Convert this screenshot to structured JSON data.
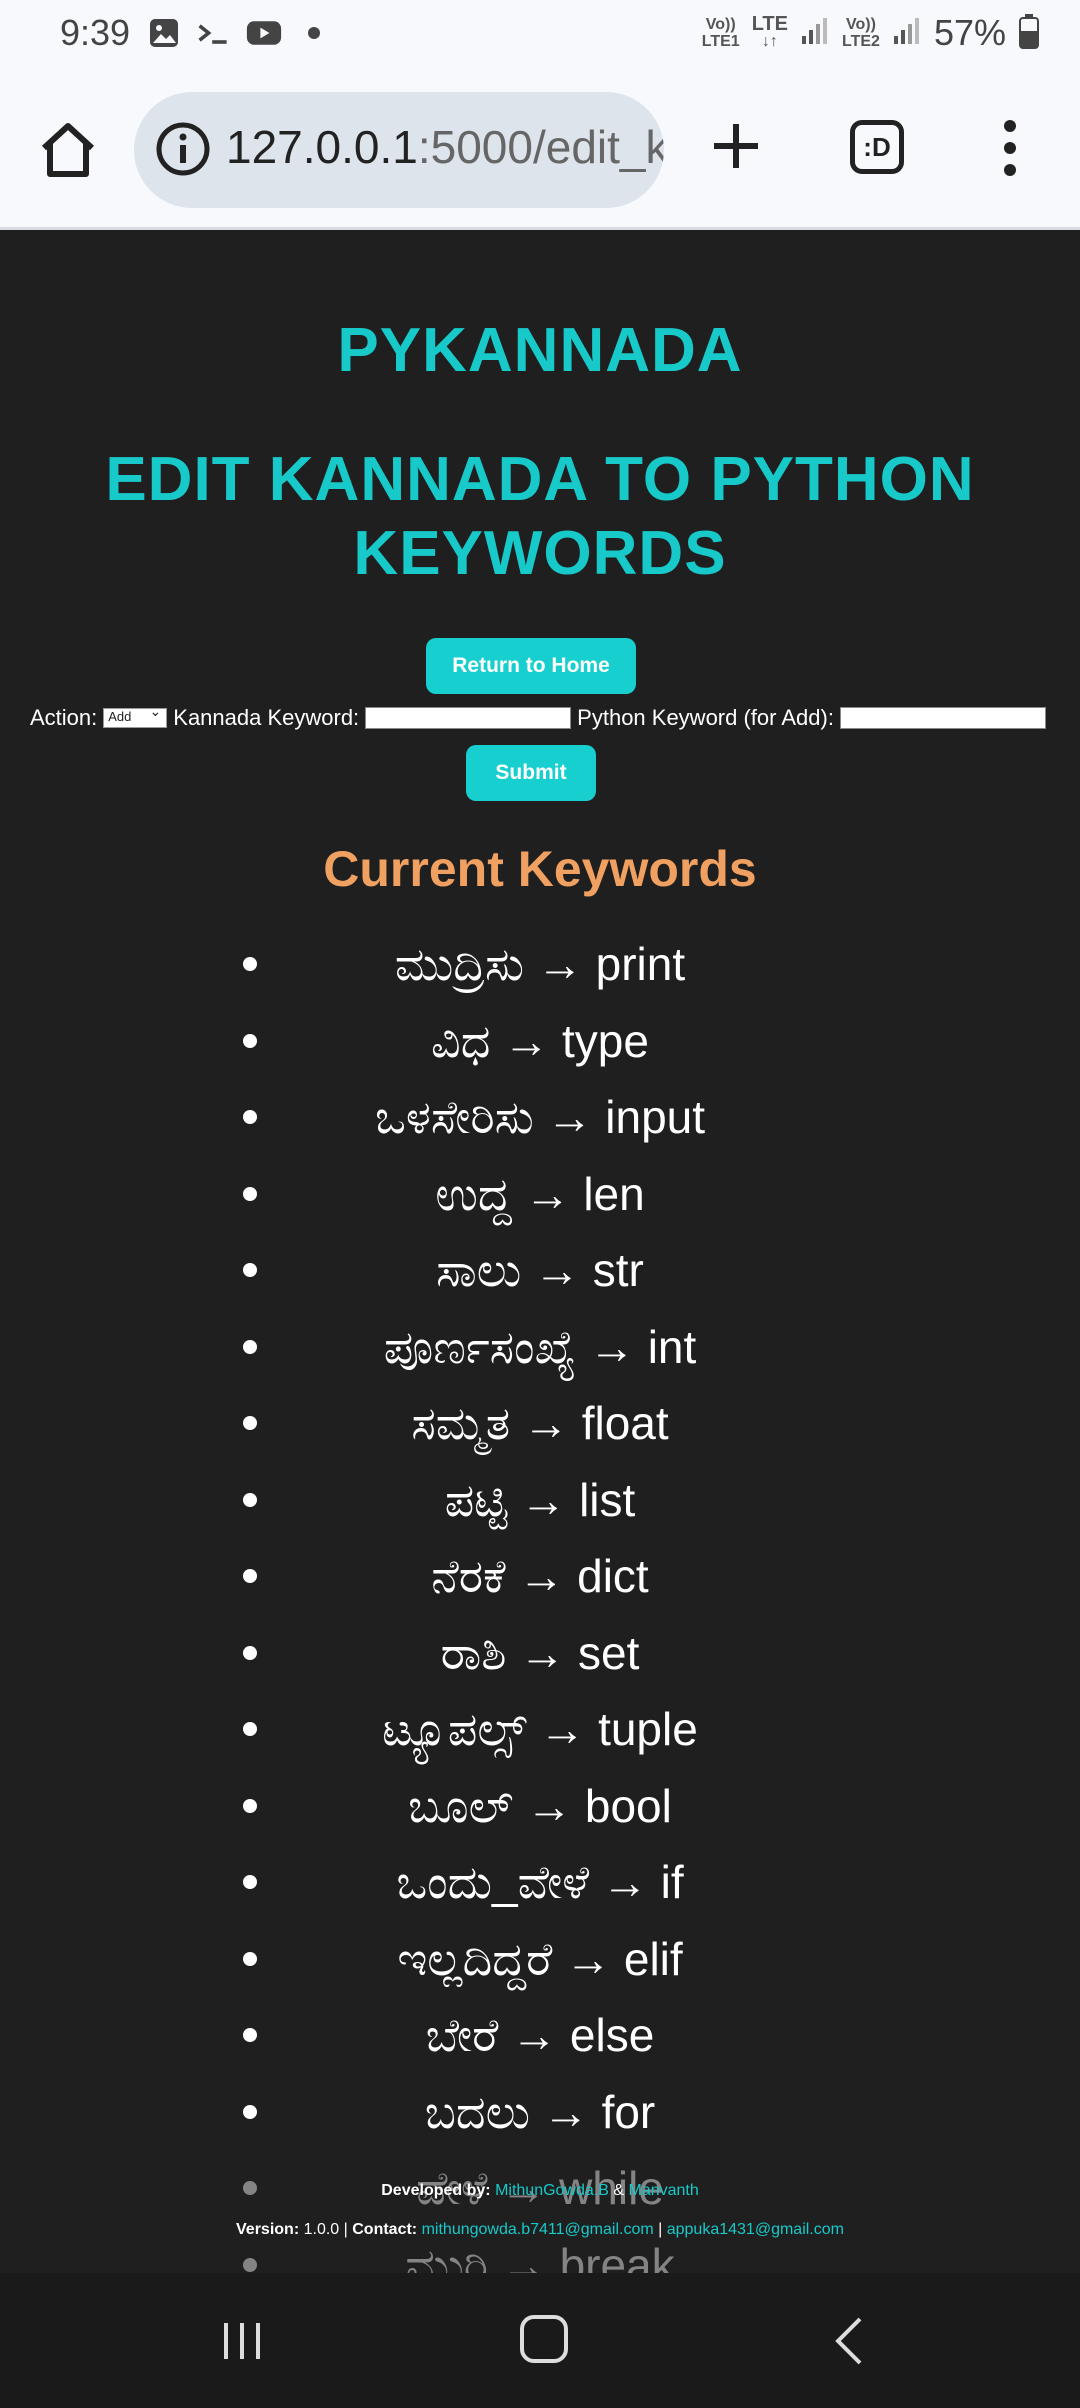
{
  "status_bar": {
    "time": "9:39",
    "icons": [
      "gallery-icon",
      "terminal-icon",
      "youtube-icon",
      "dot-icon"
    ],
    "sim1": [
      "Vo))",
      "LTE1"
    ],
    "lte": [
      "LTE",
      "↓↑"
    ],
    "sim2": [
      "Vo))",
      "LTE2"
    ],
    "battery": "57%"
  },
  "browser": {
    "url_host": "127.0.0.1",
    "url_path": ":5000/edit_k",
    "tabs_label": ":D"
  },
  "page": {
    "brand": "PYKANNADA",
    "heading_line1": "EDIT KANNADA TO PYTHON",
    "heading_line2": "KEYWORDS",
    "return_home": "Return to Home",
    "form": {
      "action_label": "Action:",
      "action_value": "Add",
      "kannada_label": "Kannada Keyword:",
      "python_label": "Python Keyword (for Add):",
      "submit": "Submit"
    },
    "current_title": "Current Keywords",
    "keywords": [
      "ಮುದ್ರಿಸು → print",
      "ವಿಧ → type",
      "ಒಳಸೇರಿಸು → input",
      "ಉದ್ದ → len",
      "ಸಾಲು → str",
      "ಪೂರ್ಣಸಂಖ್ಯೆ → int",
      "ಸಮ್ಮತ → float",
      "ಪಟ್ಟಿ → list",
      "ನೆರಕೆ → dict",
      "ರಾಶಿ → set",
      "ಟ್ಯೂಪಲ್ಸ್ → tuple",
      "ಬೂಲ್ → bool",
      "ಒಂದು_ವೇಳೆ → if",
      "ಇಲ್ಲದಿದ್ದರೆ → elif",
      "ಬೇರೆ → else",
      "ಬದಲು → for",
      "ವೇಳೆ → while",
      "ಮುರಿ → break"
    ],
    "footer": {
      "developed_by": "Developed by:",
      "dev1": "MithunGowda.B",
      "amp": "&",
      "dev2": "Manvanth",
      "version_label": "Version:",
      "version": "1.0.0 |",
      "contact_label": "Contact:",
      "email1": "mithungowda.b7411@gmail.com",
      "sep": "|",
      "email2": "appuka1431@gmail.com"
    }
  },
  "colors": {
    "accent": "#17c9c9",
    "orange": "#f0a060",
    "background": "#1f1f1f"
  }
}
